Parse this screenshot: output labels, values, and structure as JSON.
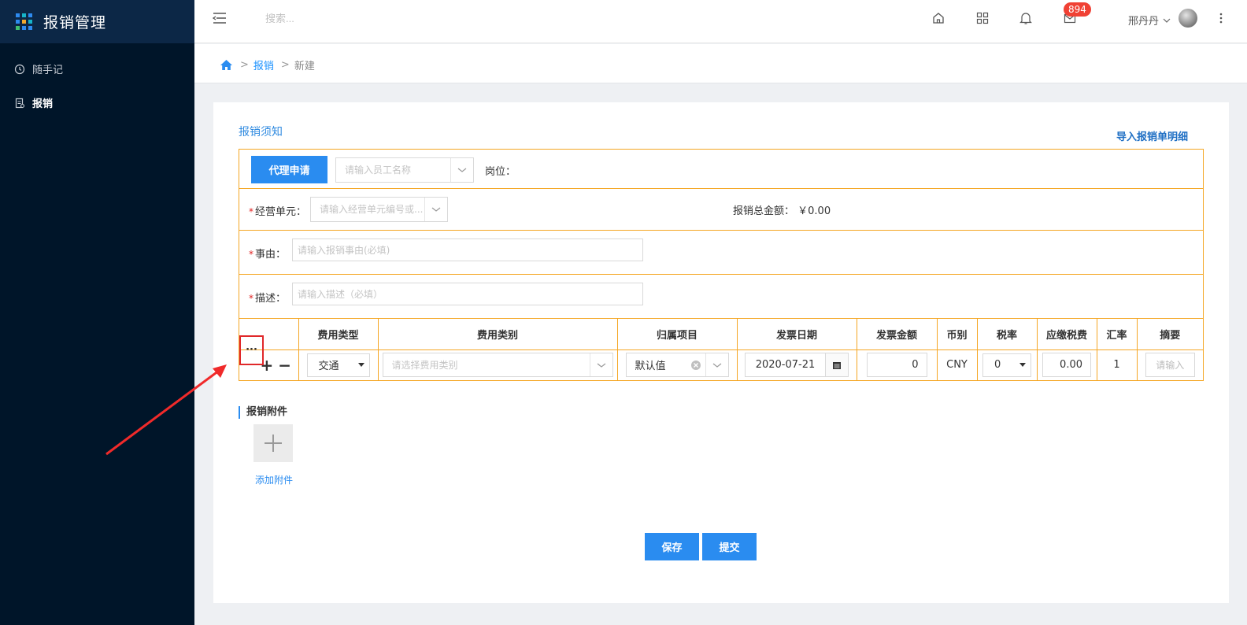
{
  "app": {
    "title": "报销管理"
  },
  "sidebar": {
    "items": [
      {
        "label": "随手记"
      },
      {
        "label": "报销"
      }
    ]
  },
  "header": {
    "search_placeholder": "搜索...",
    "mail_badge": "894",
    "user_name": "邢丹丹"
  },
  "breadcrumb": {
    "items": [
      "报销",
      "新建"
    ]
  },
  "form": {
    "notice_link": "报销须知",
    "import_link": "导入报销单明细",
    "agent_button": "代理申请",
    "employee_placeholder": "请输入员工名称",
    "position_label": "岗位：",
    "business_unit_label": "经营单元：",
    "business_unit_placeholder": "请输入经营单元编号或...",
    "total_label": "报销总金额：",
    "total_value": "￥0.00",
    "reason_label": "事由：",
    "reason_placeholder": "请输入报销事由(必填)",
    "desc_label": "描述：",
    "desc_placeholder": "请输入描述（必填）",
    "required_mark": "*"
  },
  "table": {
    "headers": [
      "",
      "费用类型",
      "费用类别",
      "归属项目",
      "发票日期",
      "发票金额",
      "币别",
      "税率",
      "应缴税费",
      "汇率",
      "摘要"
    ],
    "row": {
      "more": "···",
      "add": "+",
      "remove": "−",
      "fee_type": "交通",
      "category_placeholder": "请选择费用类别",
      "project": "默认值",
      "invoice_date": "2020-07-21",
      "invoice_amount": "0",
      "currency": "CNY",
      "tax_rate": "0",
      "tax_amount": "0.00",
      "exchange_rate": "1",
      "summary_placeholder": "请输入"
    }
  },
  "attachments": {
    "title": "报销附件",
    "add_label": "添加附件"
  },
  "actions": {
    "save": "保存",
    "submit": "提交"
  },
  "colors": {
    "accent": "#2a8cf0",
    "border_highlight": "#f5a623",
    "sidebar_bg": "#001529",
    "annotation": "#e0282a"
  }
}
